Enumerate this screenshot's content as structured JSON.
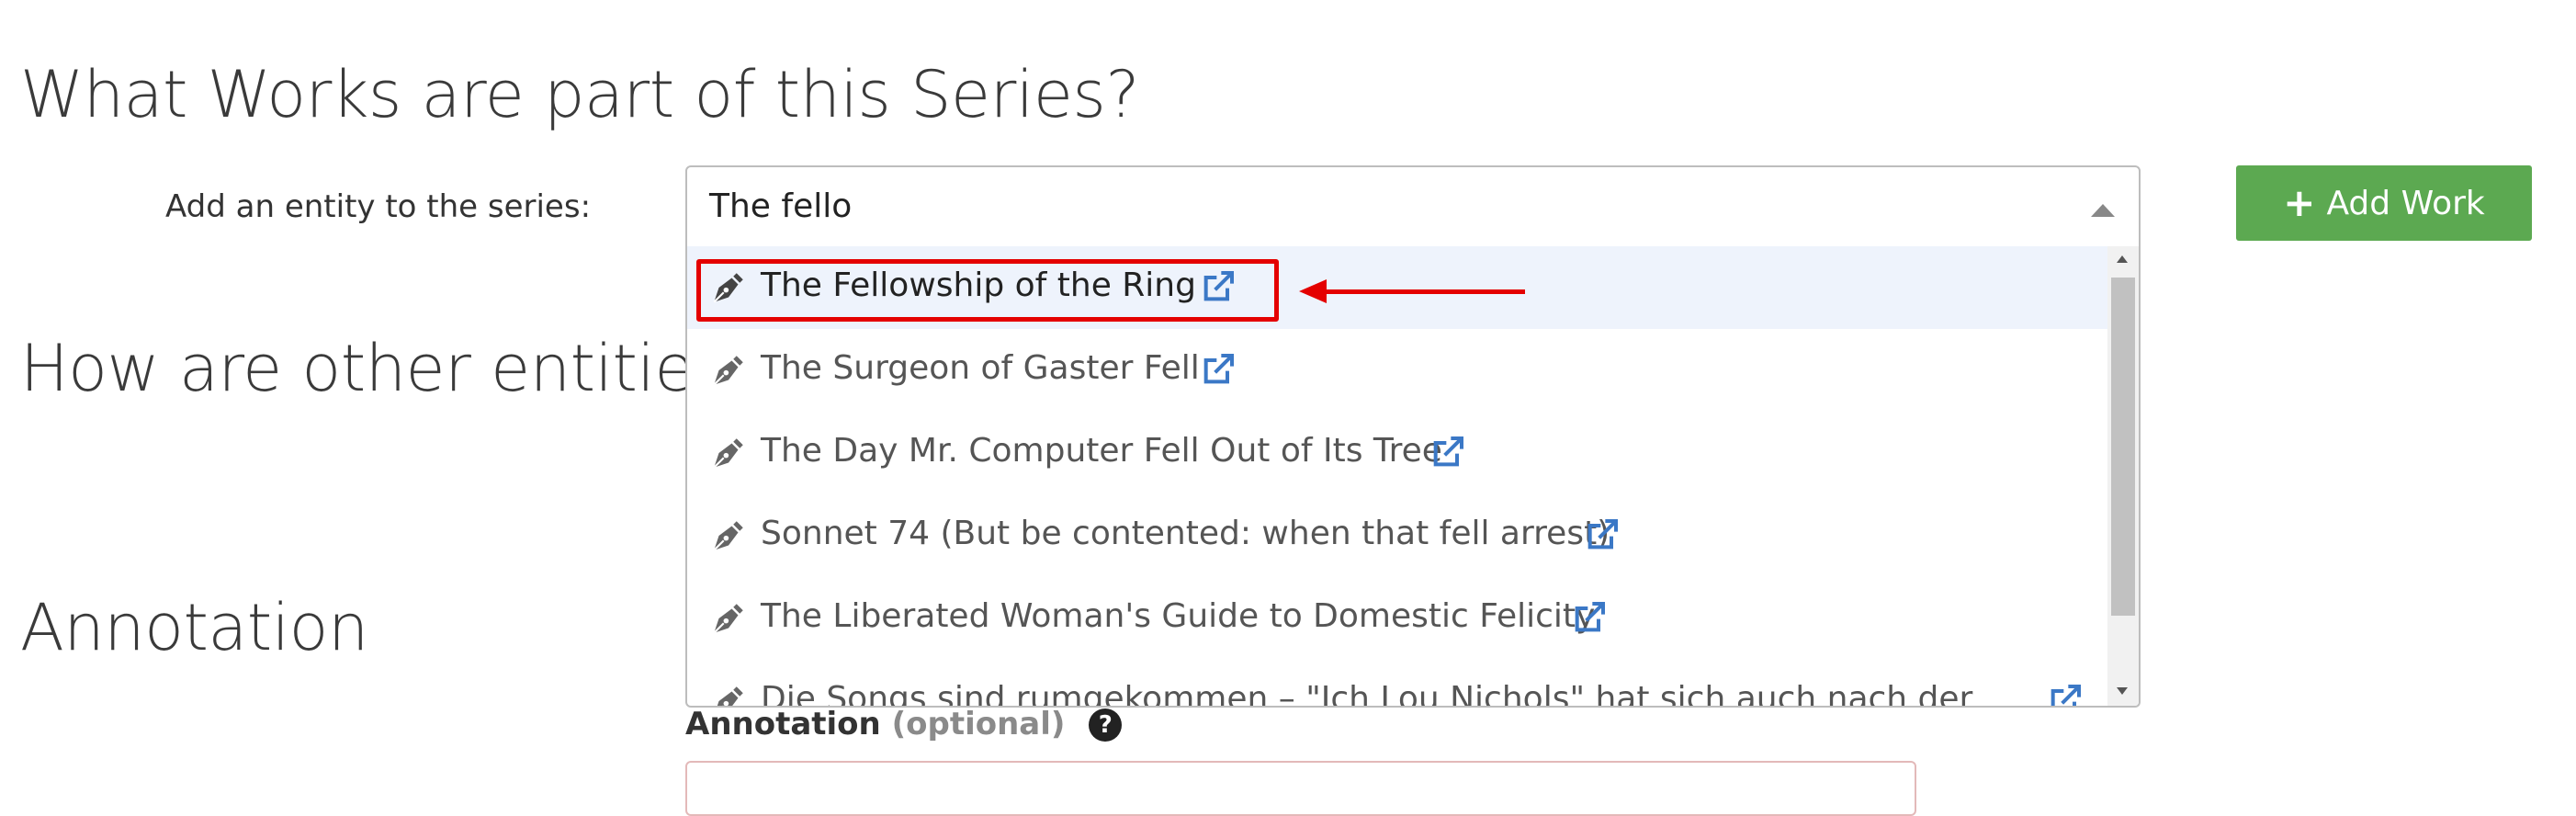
{
  "headings": {
    "works": "What Works are part of this Series?",
    "relationships": "How are other entities",
    "annotation": "Annotation"
  },
  "entity_select": {
    "label": "Add an entity to the series:",
    "value": "The fello",
    "options": [
      {
        "label": "The Fellowship of the Ring",
        "icon": "pen-nib-icon",
        "link_icon": "external-link-icon"
      },
      {
        "label": "The Surgeon of Gaster Fell",
        "icon": "pen-nib-icon",
        "link_icon": "external-link-icon"
      },
      {
        "label": "The Day Mr. Computer Fell Out of Its Tree",
        "icon": "pen-nib-icon",
        "link_icon": "external-link-icon"
      },
      {
        "label": "Sonnet 74 (But be contented: when that fell arrest)",
        "icon": "pen-nib-icon",
        "link_icon": "external-link-icon"
      },
      {
        "label": "The Liberated Woman's Guide to Domestic Felicity",
        "icon": "pen-nib-icon",
        "link_icon": "external-link-icon"
      },
      {
        "label": "Die Songs sind rumgekommen – \"Ich Lou Nichols\" hat sich auch nach der",
        "icon": "pen-nib-icon",
        "link_icon": "external-link-icon"
      }
    ]
  },
  "add_work_button": {
    "icon": "plus-icon",
    "label": "Add Work"
  },
  "annotation_field": {
    "label": "Annotation",
    "optional": "(optional)",
    "help_icon": "question-circle-icon"
  },
  "colors": {
    "highlight": "#e40000",
    "button_green": "#5ca951",
    "link_blue": "#3b78c6",
    "focused_option_bg": "#eef3fc"
  }
}
